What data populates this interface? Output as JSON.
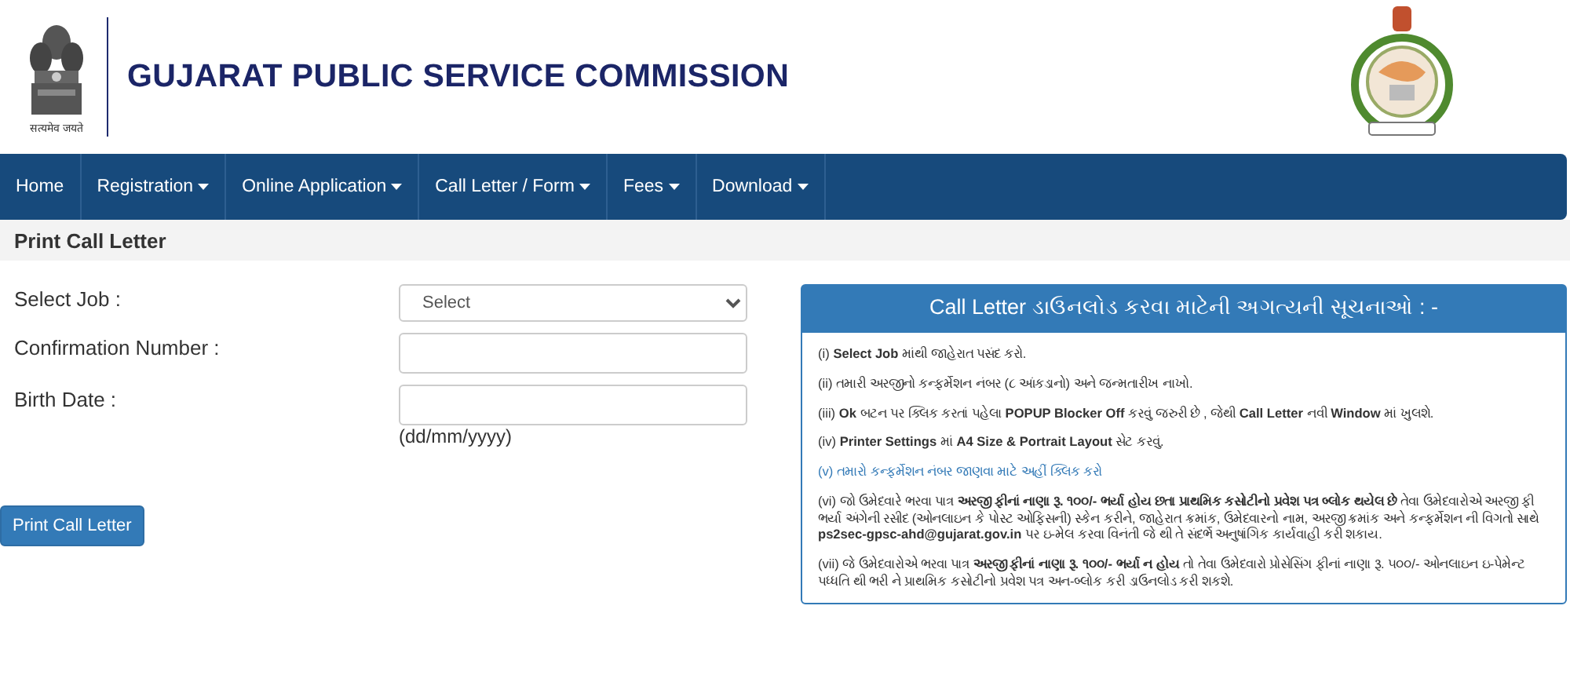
{
  "header": {
    "title": "GUJARAT PUBLIC SERVICE COMMISSION",
    "emblem_caption": "सत्यमेव जयते"
  },
  "nav": [
    {
      "label": "Home",
      "dropdown": false
    },
    {
      "label": "Registration",
      "dropdown": true
    },
    {
      "label": "Online Application",
      "dropdown": true
    },
    {
      "label": "Call Letter / Form",
      "dropdown": true
    },
    {
      "label": "Fees",
      "dropdown": true
    },
    {
      "label": "Download",
      "dropdown": true
    }
  ],
  "page_title": "Print Call Letter",
  "form": {
    "fields": [
      {
        "kind": "select",
        "label": "Select Job :",
        "value": "Select"
      },
      {
        "kind": "text",
        "label": "Confirmation Number :"
      },
      {
        "kind": "text",
        "label": "Birth Date :",
        "hint": "(dd/mm/yyyy)"
      }
    ],
    "submit": "Print Call Letter"
  },
  "instructions": {
    "title": "Call Letter ડાઉનલોડ કરવા માટેની અગત્યની સૂચનાઓ : -",
    "items": [
      {
        "kind": "text",
        "text": "(i) **Select Job** માંથી જાહેરાત પસંદ કરો."
      },
      {
        "kind": "text",
        "text": "(ii) તમારી અરજીનો કન્ફર્મેશન નંબર (૮ આંકડાનો) અને જન્મતારીખ નાખો."
      },
      {
        "kind": "text",
        "text": "(iii) **Ok** બટન પર ક્લિક કરતાં પહેલા **POPUP Blocker Off** કરવું જરુરી છે , જેથી **Call Letter** નવી **Window** માં ખુલશે."
      },
      {
        "kind": "text",
        "text": "(iv) **Printer Settings** માં **A4 Size & Portrait Layout** સેટ કરવું."
      },
      {
        "kind": "link",
        "text": "(v) તમારો કન્ફર્મેશન નંબર જાણવા માટે અહીં ક્લિક કરો"
      },
      {
        "kind": "text",
        "text": "(vi) જો ઉમેદવારે ભરવા પાત્ર **અરજી ફીનાં નાણા રૂ. ૧૦૦/- ભર્યા હોય છતા પ્રાથમિક કસોટીનો પ્રવેશ પત્ર બ્લોક થયેલ છે** તેવા ઉમેદવારોએ અરજી ફી ભર્યા અંગેની રસીદ (ઓનલાઇન કે પોસ્ટ ઓફિસની) સ્કેન કરીને, જાહેરાત ક્રમાંક, ઉમેદવારનો નામ, અરજી ક્રમાંક અને કન્ફર્મેશન ની વિગતો સાથે **ps2sec-gpsc-ahd@gujarat.gov.in** પર ઇ-મેલ કરવા વિનંતી જે થી તે સંદર્ભે અનુષાંગિક કાર્યવાહી કરી શકાય."
      },
      {
        "kind": "text",
        "text": "(vii) જે ઉમેદવારોએ ભરવા પાત્ર **અરજી ફીનાં નાણા રૂ. ૧૦૦/- ભર્યા ન હોય** તો તેવા ઉમેદવારો પ્રોસેસિંગ ફીનાં નાણા રૂ. ૫૦૦/- ઓનલાઇન ઇ-પેમેન્ટ પધ્ધતિ થી ભરી ને પ્રાથમિક કસોટીનો પ્રવેશ પત્ર અન-બ્લોક કરી ડાઉનલોડ કરી શકશે."
      }
    ]
  }
}
